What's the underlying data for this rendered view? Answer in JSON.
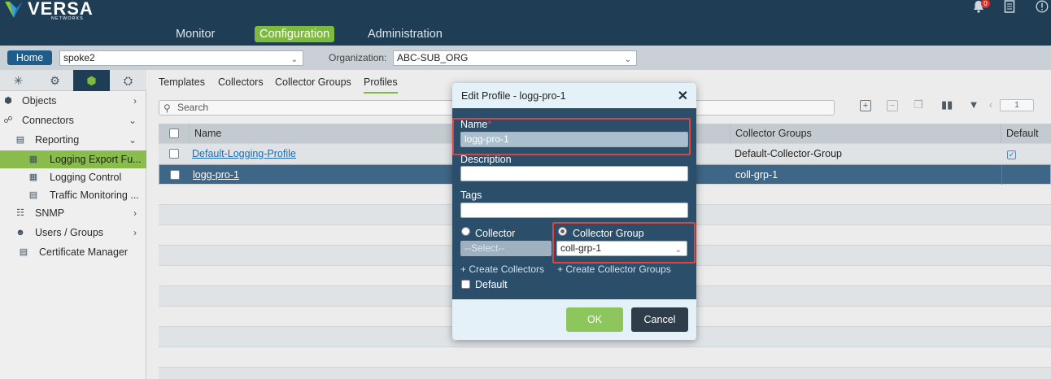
{
  "brand": {
    "name": "VERSA",
    "sub": "NETWORKS"
  },
  "nav": {
    "items": [
      "Monitor",
      "Configuration",
      "Administration"
    ],
    "active": "Configuration"
  },
  "header_icons": {
    "bell": "bell-icon",
    "bell_badge": "0",
    "doc": "document-icon",
    "info": "info-icon"
  },
  "subbar": {
    "home_label": "Home",
    "appliance": "spoke2",
    "org_label": "Organization:",
    "org": "ABC-SUB_ORG"
  },
  "sidebar": {
    "tab_icons": [
      "topology-icon",
      "gear-icon",
      "cube-icon",
      "globe-gear-icon"
    ],
    "items": [
      {
        "label": "Objects",
        "icon": "cube-icon",
        "arrow": "›",
        "level": 0
      },
      {
        "label": "Connectors",
        "icon": "connectors-icon",
        "arrow": "⌄",
        "level": 0
      },
      {
        "label": "Reporting",
        "icon": "chart-icon",
        "arrow": "⌄",
        "level": 1
      },
      {
        "label": "Logging Export Fu...",
        "icon": "export-icon",
        "arrow": "",
        "level": 2,
        "selected": true
      },
      {
        "label": "Logging Control",
        "icon": "log-control-icon",
        "arrow": "",
        "level": 2
      },
      {
        "label": "Traffic Monitoring ...",
        "icon": "traffic-icon",
        "arrow": "",
        "level": 2
      },
      {
        "label": "SNMP",
        "icon": "snmp-icon",
        "arrow": "›",
        "level": 1
      },
      {
        "label": "Users / Groups",
        "icon": "users-icon",
        "arrow": "›",
        "level": 1
      },
      {
        "label": "Certificate Manager",
        "icon": "certificate-icon",
        "arrow": "",
        "level": 1
      }
    ]
  },
  "tabs": [
    "Templates",
    "Collectors",
    "Collector Groups",
    "Profiles"
  ],
  "active_tab": "Profiles",
  "search": {
    "placeholder": "Search"
  },
  "toolbar": {
    "pager_value": "1"
  },
  "table": {
    "columns": [
      "Name",
      "Collector Groups",
      "Default"
    ],
    "rows": [
      {
        "name": "Default-Logging-Profile",
        "collector_groups": "Default-Collector-Group",
        "default": true
      },
      {
        "name": "logg-pro-1",
        "collector_groups": "coll-grp-1",
        "default": false
      }
    ]
  },
  "modal": {
    "title": "Edit Profile - logg-pro-1",
    "name_label": "Name",
    "name_required": "*",
    "name_value": "logg-pro-1",
    "description_label": "Description",
    "description_value": "",
    "tags_label": "Tags",
    "tags_value": "",
    "collector_label": "Collector",
    "collector_placeholder": "--Select--",
    "collector_group_label": "Collector Group",
    "collector_group_value": "coll-grp-1",
    "create_collectors": "+ Create Collectors",
    "create_collector_groups": "+ Create Collector Groups",
    "default_label": "Default",
    "ok_label": "OK",
    "cancel_label": "Cancel"
  }
}
